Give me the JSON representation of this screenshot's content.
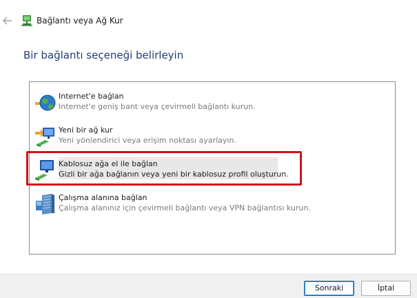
{
  "window": {
    "title": "Bağlantı veya Ağ Kur"
  },
  "heading": "Bir bağlantı seçeneği belirleyin",
  "options": [
    {
      "title": "Internet'e bağlan",
      "description": "Internet'e geniş bant veya çevirmeli bağlantı kurun.",
      "icon": "globe-network-icon",
      "selected": false
    },
    {
      "title": "Yeni bir ağ kur",
      "description": "Yeni yönlendirici veya erişim noktası ayarlayın.",
      "icon": "router-setup-icon",
      "selected": false
    },
    {
      "title": "Kablosuz ağa el ile bağlan",
      "description": "Gizli bir ağa bağlanın veya yeni bir kablosuz profil oluşturun.",
      "icon": "wireless-monitor-icon",
      "selected": true
    },
    {
      "title": "Çalışma alanına bağlan",
      "description": "Çalışma alanınız için çevirmeli bağlantı veya VPN bağlantısı kurun.",
      "icon": "workplace-server-icon",
      "selected": false
    }
  ],
  "buttons": {
    "next": "Sonraki",
    "cancel": "İptal"
  },
  "colors": {
    "heading": "#1f3d7a",
    "highlight": "#d0101c",
    "selection": "#e8e8e8",
    "primary_border": "#0067c0"
  }
}
